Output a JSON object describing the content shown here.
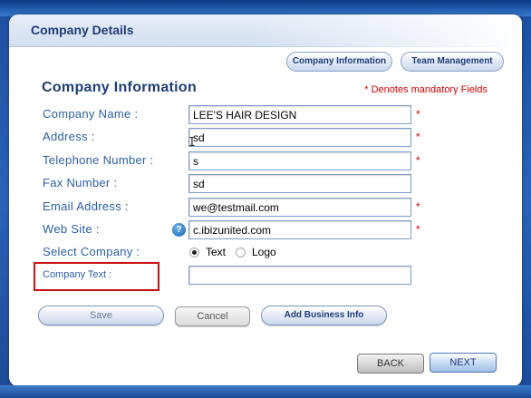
{
  "header": {
    "title": "Company Details"
  },
  "tabs": [
    {
      "label": "Company Information"
    },
    {
      "label": "Team Management"
    }
  ],
  "section": {
    "title": "Company Information",
    "mandatory_note": "* Denotes mandatory Fields"
  },
  "fields": {
    "company_name": {
      "label": "Company Name :",
      "value": "LEE'S HAIR DESIGN",
      "required": "*"
    },
    "address": {
      "label": "Address :",
      "value": "sd",
      "required": "*"
    },
    "telephone": {
      "label": "Telephone Number :",
      "value": "s",
      "required": "*"
    },
    "fax": {
      "label": "Fax Number :",
      "value": "sd"
    },
    "email": {
      "label": "Email Address :",
      "value": "we@testmail.com",
      "required": "*"
    },
    "website": {
      "label": "Web Site :",
      "value": "c.ibizunited.com",
      "required": "*",
      "help": "?"
    },
    "select_company": {
      "label": "Select Company :",
      "options": [
        "Text",
        "Logo"
      ],
      "selected": "Text"
    },
    "company_text": {
      "label": "Company Text :",
      "value": ""
    }
  },
  "buttons": {
    "save": "Save",
    "cancel": "Cancel",
    "add_business_info": "Add Business Info",
    "back": "BACK",
    "next": "NEXT"
  },
  "colors": {
    "frame_blue": "#2a63b8",
    "title_blue": "#1e3d7a",
    "label_blue": "#2a5ea8",
    "required_red": "#d40000",
    "highlight_red": "#cc1010"
  }
}
